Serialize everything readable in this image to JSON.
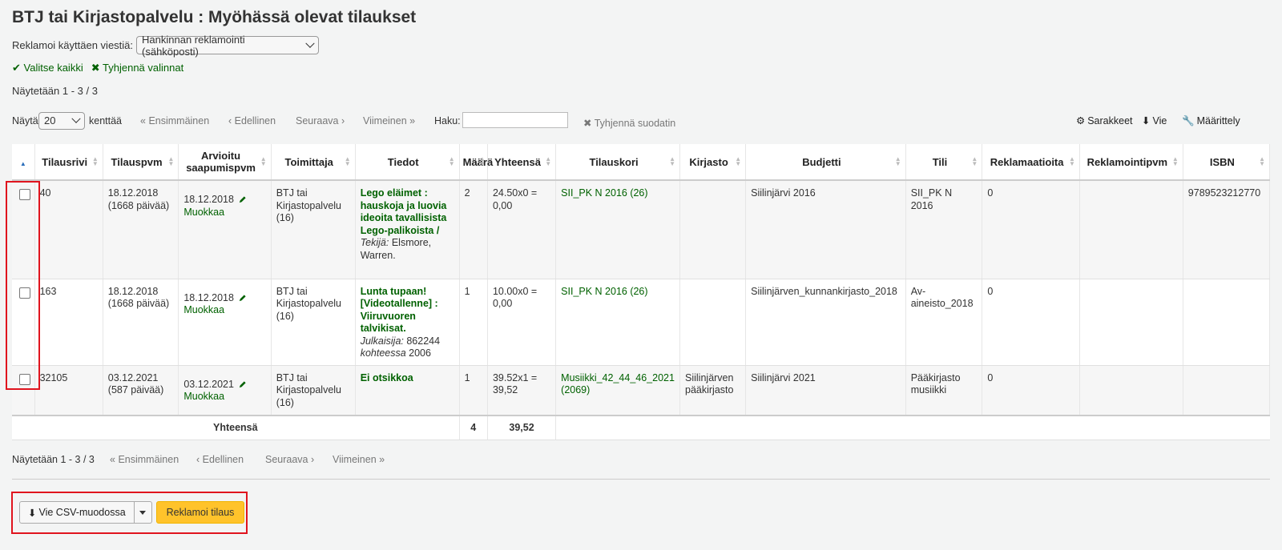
{
  "page": {
    "title": "BTJ tai Kirjastopalvelu : Myöhässä olevat tilaukset"
  },
  "claim": {
    "label": "Reklamoi käyttäen viestiä:",
    "selected": "Hankinnan reklamointi (sähköposti)"
  },
  "selection": {
    "select_all": "Valitse kaikki",
    "clear_all": "Tyhjennä valinnat"
  },
  "showing_top": "Näytetään 1 - 3 / 3",
  "toolbar": {
    "show_label": "Näytä",
    "page_size": "20",
    "entries_label": "kenttää",
    "first": "Ensimmäinen",
    "prev": "Edellinen",
    "next": "Seuraava",
    "last": "Viimeinen",
    "search_label": "Haku:",
    "search_value": "",
    "clear_filter": "Tyhjennä suodatin",
    "columns": "Sarakkeet",
    "export": "Vie",
    "configure": "Määrittely"
  },
  "columns": [
    "Tilausrivi",
    "Tilauspvm",
    "Arvioitu saapumispvm",
    "Toimittaja",
    "Tiedot",
    "Määrä",
    "Yhteensä",
    "Tilauskori",
    "Kirjasto",
    "Budjetti",
    "Tili",
    "Reklamaatioita",
    "Reklamointipvm",
    "ISBN"
  ],
  "rows": [
    {
      "orderline": "40",
      "orderdate": "18.12.2018",
      "orderdays": "(1668 päivää)",
      "estimated": "18.12.2018",
      "edit": "Muokkaa",
      "vendor": "BTJ tai Kirjastopalvelu (16)",
      "title": "Lego eläimet : hauskoja ja luovia ideoita tavallisista Lego-palikoista /",
      "meta1_label": "Tekijä:",
      "meta1_value": " Elsmore, Warren.",
      "meta2_label": "",
      "meta2_value": "",
      "quantity": "2",
      "total": "24.50x0 = 0,00",
      "basket": "SII_PK N 2016 (26)",
      "library": "",
      "budget": "Siilinjärvi 2016",
      "fund": "SII_PK N 2016",
      "claims": "0",
      "claimdate": "",
      "isbn": "9789523212770"
    },
    {
      "orderline": "163",
      "orderdate": "18.12.2018",
      "orderdays": "(1668 päivää)",
      "estimated": "18.12.2018",
      "edit": "Muokkaa",
      "vendor": "BTJ tai Kirjastopalvelu (16)",
      "title": "Lunta tupaan! [Videotallenne] : Viiruvuoren talvikisat.",
      "meta1_label": "Julkaisija:",
      "meta1_value": " 862244",
      "meta2_label": "kohteessa",
      "meta2_value": " 2006",
      "quantity": "1",
      "total": "10.00x0 = 0,00",
      "basket": "SII_PK N 2016 (26)",
      "library": "",
      "budget": "Siilinjärven_kunnankirjasto_2018",
      "fund": "Av-aineisto_2018",
      "claims": "0",
      "claimdate": "",
      "isbn": ""
    },
    {
      "orderline": "32105",
      "orderdate": "03.12.2021",
      "orderdays": "(587 päivää)",
      "estimated": "03.12.2021",
      "edit": "Muokkaa",
      "vendor": "BTJ tai Kirjastopalvelu (16)",
      "title": "Ei otsikkoa",
      "meta1_label": "",
      "meta1_value": "",
      "meta2_label": "",
      "meta2_value": "",
      "quantity": "1",
      "total": "39.52x1 = 39,52",
      "basket": "Musiikki_42_44_46_2021 (2069)",
      "library": "Siilinjärven pääkirjasto",
      "budget": "Siilinjärvi 2021",
      "fund": "Pääkirjasto musiikki",
      "claims": "0",
      "claimdate": "",
      "isbn": ""
    }
  ],
  "footer": {
    "label": "Yhteensä",
    "quantity": "4",
    "total": "39,52"
  },
  "showing_bottom": "Näytetään 1 - 3 / 3",
  "actions": {
    "export_csv": "Vie CSV-muodossa",
    "claim": "Reklamoi tilaus"
  },
  "colors": {
    "link": "#006100",
    "claim_button": "#ffc32b",
    "highlight": "#e0141e"
  }
}
